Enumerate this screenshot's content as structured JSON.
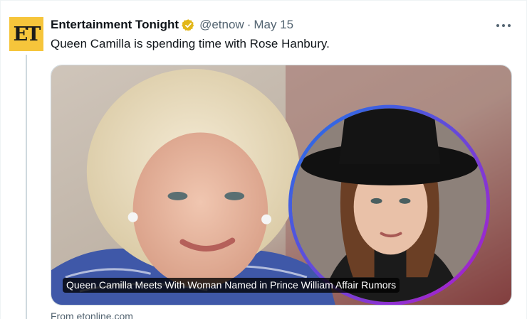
{
  "tweet": {
    "author_name": "Entertainment Tonight",
    "avatar_text": "ET",
    "handle": "@etnow",
    "separator": "·",
    "date": "May 15",
    "text": "Queen Camilla is spending time with Rose Hanbury."
  },
  "card": {
    "headline": "Queen Camilla Meets With Woman Named in Prince William Affair Rumors",
    "source": "From etonline.com"
  },
  "colors": {
    "avatar_bg": "#f6c53b",
    "verified_badge": "#e2b719",
    "secondary_text": "#536471",
    "primary_text": "#0f1419",
    "ring_gradient_start": "#1d74e8",
    "ring_gradient_end": "#b41ac9"
  },
  "icons": {
    "verified": "verified-badge-icon",
    "more": "more-options-icon"
  }
}
